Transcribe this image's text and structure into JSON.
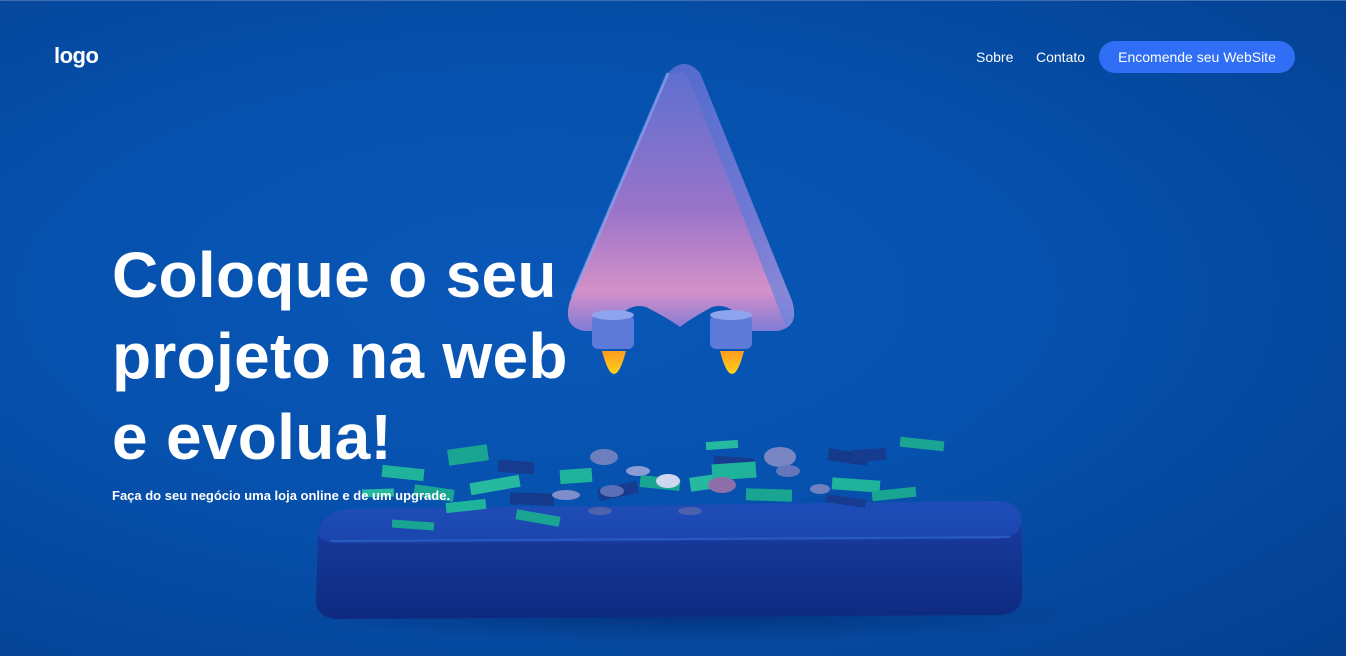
{
  "header": {
    "logo": "logo",
    "nav": [
      {
        "label": "Sobre"
      },
      {
        "label": "Contato"
      }
    ],
    "cta_label": "Encomende seu WebSite"
  },
  "hero": {
    "headline_lines": [
      "Coloque o seu",
      "projeto na web",
      "e evolua!"
    ],
    "subtitle": "Faça do seu negócio uma loja online e de um upgrade."
  },
  "colors": {
    "background": "#0651ad",
    "cta_button": "#2f6ef5",
    "text": "#ffffff"
  },
  "illustration": {
    "icons": [
      "rocket-icon",
      "platform",
      "banknotes",
      "coins"
    ]
  }
}
